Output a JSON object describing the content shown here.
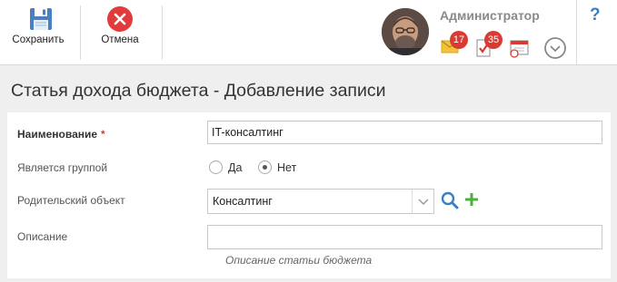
{
  "toolbar": {
    "save_label": "Сохранить",
    "cancel_label": "Отмена",
    "colors": {
      "save": "#4a7fc4",
      "cancel": "#e03c3c"
    }
  },
  "user": {
    "name": "Администратор",
    "mail_count": "17",
    "task_count": "35"
  },
  "help": {
    "label": "?"
  },
  "page": {
    "title": "Статья дохода бюджета - Добавление записи"
  },
  "form": {
    "name": {
      "label": "Наименование",
      "required_mark": "*",
      "value": "IT-консалтинг"
    },
    "is_group": {
      "label": "Является группой",
      "options": [
        "Да",
        "Нет"
      ],
      "selected": "Нет"
    },
    "parent": {
      "label": "Родительский объект",
      "value": "Консалтинг"
    },
    "description": {
      "label": "Описание",
      "value": "",
      "hint": "Описание статьи бюджета"
    }
  },
  "icons": {
    "save": "floppy-disk-icon",
    "cancel": "close-icon",
    "mail": "mail-icon",
    "tasks": "task-check-icon",
    "calendar": "calendar-icon",
    "menu": "chevron-down-circle-icon",
    "search": "search-icon",
    "add": "plus-icon"
  }
}
